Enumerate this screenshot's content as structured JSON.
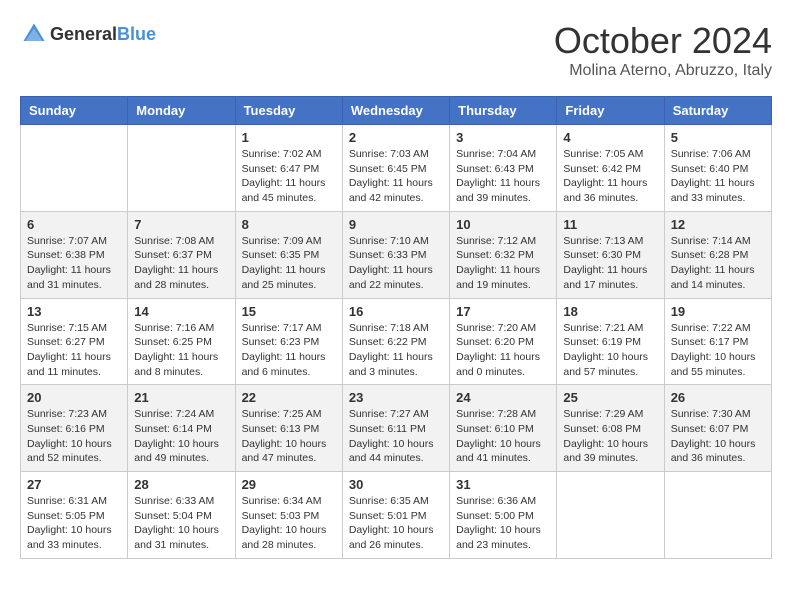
{
  "header": {
    "logo_general": "General",
    "logo_blue": "Blue",
    "month": "October 2024",
    "location": "Molina Aterno, Abruzzo, Italy"
  },
  "weekdays": [
    "Sunday",
    "Monday",
    "Tuesday",
    "Wednesday",
    "Thursday",
    "Friday",
    "Saturday"
  ],
  "weeks": [
    [
      null,
      null,
      {
        "day": 1,
        "sunrise": "Sunrise: 7:02 AM",
        "sunset": "Sunset: 6:47 PM",
        "daylight": "Daylight: 11 hours and 45 minutes."
      },
      {
        "day": 2,
        "sunrise": "Sunrise: 7:03 AM",
        "sunset": "Sunset: 6:45 PM",
        "daylight": "Daylight: 11 hours and 42 minutes."
      },
      {
        "day": 3,
        "sunrise": "Sunrise: 7:04 AM",
        "sunset": "Sunset: 6:43 PM",
        "daylight": "Daylight: 11 hours and 39 minutes."
      },
      {
        "day": 4,
        "sunrise": "Sunrise: 7:05 AM",
        "sunset": "Sunset: 6:42 PM",
        "daylight": "Daylight: 11 hours and 36 minutes."
      },
      {
        "day": 5,
        "sunrise": "Sunrise: 7:06 AM",
        "sunset": "Sunset: 6:40 PM",
        "daylight": "Daylight: 11 hours and 33 minutes."
      }
    ],
    [
      {
        "day": 6,
        "sunrise": "Sunrise: 7:07 AM",
        "sunset": "Sunset: 6:38 PM",
        "daylight": "Daylight: 11 hours and 31 minutes."
      },
      {
        "day": 7,
        "sunrise": "Sunrise: 7:08 AM",
        "sunset": "Sunset: 6:37 PM",
        "daylight": "Daylight: 11 hours and 28 minutes."
      },
      {
        "day": 8,
        "sunrise": "Sunrise: 7:09 AM",
        "sunset": "Sunset: 6:35 PM",
        "daylight": "Daylight: 11 hours and 25 minutes."
      },
      {
        "day": 9,
        "sunrise": "Sunrise: 7:10 AM",
        "sunset": "Sunset: 6:33 PM",
        "daylight": "Daylight: 11 hours and 22 minutes."
      },
      {
        "day": 10,
        "sunrise": "Sunrise: 7:12 AM",
        "sunset": "Sunset: 6:32 PM",
        "daylight": "Daylight: 11 hours and 19 minutes."
      },
      {
        "day": 11,
        "sunrise": "Sunrise: 7:13 AM",
        "sunset": "Sunset: 6:30 PM",
        "daylight": "Daylight: 11 hours and 17 minutes."
      },
      {
        "day": 12,
        "sunrise": "Sunrise: 7:14 AM",
        "sunset": "Sunset: 6:28 PM",
        "daylight": "Daylight: 11 hours and 14 minutes."
      }
    ],
    [
      {
        "day": 13,
        "sunrise": "Sunrise: 7:15 AM",
        "sunset": "Sunset: 6:27 PM",
        "daylight": "Daylight: 11 hours and 11 minutes."
      },
      {
        "day": 14,
        "sunrise": "Sunrise: 7:16 AM",
        "sunset": "Sunset: 6:25 PM",
        "daylight": "Daylight: 11 hours and 8 minutes."
      },
      {
        "day": 15,
        "sunrise": "Sunrise: 7:17 AM",
        "sunset": "Sunset: 6:23 PM",
        "daylight": "Daylight: 11 hours and 6 minutes."
      },
      {
        "day": 16,
        "sunrise": "Sunrise: 7:18 AM",
        "sunset": "Sunset: 6:22 PM",
        "daylight": "Daylight: 11 hours and 3 minutes."
      },
      {
        "day": 17,
        "sunrise": "Sunrise: 7:20 AM",
        "sunset": "Sunset: 6:20 PM",
        "daylight": "Daylight: 11 hours and 0 minutes."
      },
      {
        "day": 18,
        "sunrise": "Sunrise: 7:21 AM",
        "sunset": "Sunset: 6:19 PM",
        "daylight": "Daylight: 10 hours and 57 minutes."
      },
      {
        "day": 19,
        "sunrise": "Sunrise: 7:22 AM",
        "sunset": "Sunset: 6:17 PM",
        "daylight": "Daylight: 10 hours and 55 minutes."
      }
    ],
    [
      {
        "day": 20,
        "sunrise": "Sunrise: 7:23 AM",
        "sunset": "Sunset: 6:16 PM",
        "daylight": "Daylight: 10 hours and 52 minutes."
      },
      {
        "day": 21,
        "sunrise": "Sunrise: 7:24 AM",
        "sunset": "Sunset: 6:14 PM",
        "daylight": "Daylight: 10 hours and 49 minutes."
      },
      {
        "day": 22,
        "sunrise": "Sunrise: 7:25 AM",
        "sunset": "Sunset: 6:13 PM",
        "daylight": "Daylight: 10 hours and 47 minutes."
      },
      {
        "day": 23,
        "sunrise": "Sunrise: 7:27 AM",
        "sunset": "Sunset: 6:11 PM",
        "daylight": "Daylight: 10 hours and 44 minutes."
      },
      {
        "day": 24,
        "sunrise": "Sunrise: 7:28 AM",
        "sunset": "Sunset: 6:10 PM",
        "daylight": "Daylight: 10 hours and 41 minutes."
      },
      {
        "day": 25,
        "sunrise": "Sunrise: 7:29 AM",
        "sunset": "Sunset: 6:08 PM",
        "daylight": "Daylight: 10 hours and 39 minutes."
      },
      {
        "day": 26,
        "sunrise": "Sunrise: 7:30 AM",
        "sunset": "Sunset: 6:07 PM",
        "daylight": "Daylight: 10 hours and 36 minutes."
      }
    ],
    [
      {
        "day": 27,
        "sunrise": "Sunrise: 6:31 AM",
        "sunset": "Sunset: 5:05 PM",
        "daylight": "Daylight: 10 hours and 33 minutes."
      },
      {
        "day": 28,
        "sunrise": "Sunrise: 6:33 AM",
        "sunset": "Sunset: 5:04 PM",
        "daylight": "Daylight: 10 hours and 31 minutes."
      },
      {
        "day": 29,
        "sunrise": "Sunrise: 6:34 AM",
        "sunset": "Sunset: 5:03 PM",
        "daylight": "Daylight: 10 hours and 28 minutes."
      },
      {
        "day": 30,
        "sunrise": "Sunrise: 6:35 AM",
        "sunset": "Sunset: 5:01 PM",
        "daylight": "Daylight: 10 hours and 26 minutes."
      },
      {
        "day": 31,
        "sunrise": "Sunrise: 6:36 AM",
        "sunset": "Sunset: 5:00 PM",
        "daylight": "Daylight: 10 hours and 23 minutes."
      },
      null,
      null
    ]
  ]
}
